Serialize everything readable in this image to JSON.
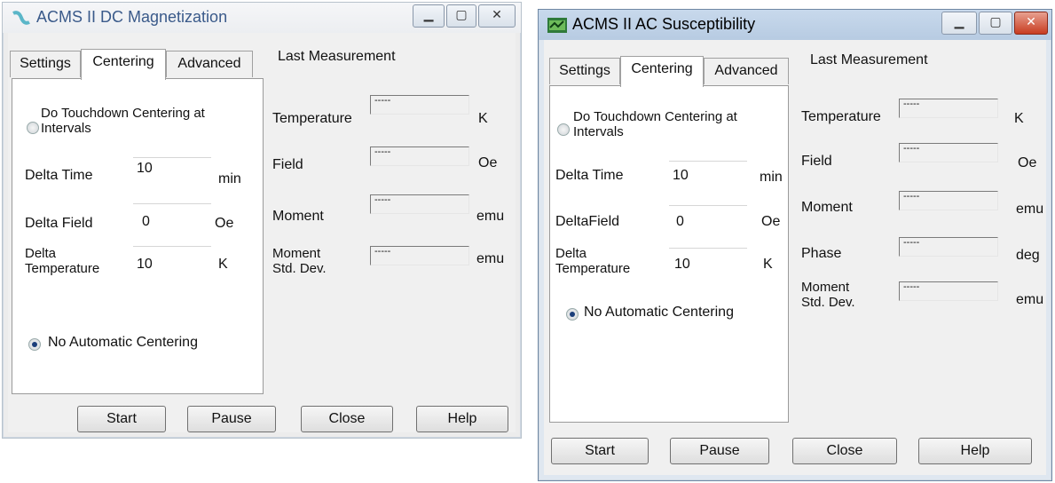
{
  "win1": {
    "title": "ACMS II DC Magnetization",
    "tabs": [
      "Settings",
      "Centering",
      "Advanced"
    ],
    "radio_touchdown": "Do Touchdown Centering at\nIntervals",
    "delta_time_label": "Delta Time",
    "delta_time_value": "10",
    "delta_time_unit": "min",
    "delta_field_label": "Delta Field",
    "delta_field_value": "0",
    "delta_field_unit": "Oe",
    "delta_temp_label": "Delta\nTemperature",
    "delta_temp_value": "10",
    "delta_temp_unit": "K",
    "radio_no_auto": "No Automatic Centering",
    "last_measurement": "Last Measurement",
    "measurements": [
      {
        "label": "Temperature",
        "value": "-----",
        "unit": "K"
      },
      {
        "label": "Field",
        "value": "-----",
        "unit": "Oe"
      },
      {
        "label": "Moment",
        "value": "-----",
        "unit": "emu"
      },
      {
        "label": "Moment\nStd. Dev.",
        "value": "-----",
        "unit": "emu"
      }
    ],
    "buttons": [
      "Start",
      "Pause",
      "Close",
      "Help"
    ]
  },
  "win2": {
    "title": "ACMS II AC Susceptibility",
    "tabs": [
      "Settings",
      "Centering",
      "Advanced"
    ],
    "radio_touchdown": "Do Touchdown Centering at\nIntervals",
    "delta_time_label": "Delta Time",
    "delta_time_value": "10",
    "delta_time_unit": "min",
    "delta_field_label": "DeltaField",
    "delta_field_value": "0",
    "delta_field_unit": "Oe",
    "delta_temp_label": "Delta\nTemperature",
    "delta_temp_value": "10",
    "delta_temp_unit": "K",
    "radio_no_auto": "No Automatic Centering",
    "last_measurement": "Last Measurement",
    "measurements": [
      {
        "label": "Temperature",
        "value": "-----",
        "unit": "K"
      },
      {
        "label": "Field",
        "value": "-----",
        "unit": "Oe"
      },
      {
        "label": "Moment",
        "value": "-----",
        "unit": "emu"
      },
      {
        "label": "Phase",
        "value": "-----",
        "unit": "deg"
      },
      {
        "label": "Moment\nStd. Dev.",
        "value": "-----",
        "unit": "emu"
      }
    ],
    "buttons": [
      "Start",
      "Pause",
      "Close",
      "Help"
    ]
  },
  "icons": {
    "win1_app": "app-icon-dc",
    "win2_app": "app-icon-ac",
    "minimize": "minimize-icon",
    "maximize": "maximize-icon",
    "close": "close-icon"
  },
  "colors": {
    "win1_title": "#3a5a8a",
    "win2_frame": "#6f87a3",
    "close_red": "#c83c20"
  }
}
